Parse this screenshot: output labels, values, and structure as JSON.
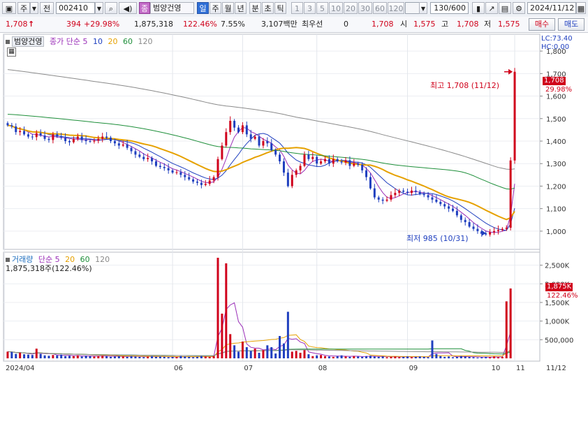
{
  "toolbar": {
    "mode_label": "주",
    "prev_label": "전",
    "code": "002410",
    "stock_badge": "종",
    "stock_name": "범양건영",
    "periods": [
      "일",
      "주",
      "월",
      "년",
      "분",
      "초",
      "틱"
    ],
    "active_period": "일",
    "intervals": [
      "1",
      "3",
      "5",
      "10",
      "20",
      "30",
      "60",
      "120"
    ],
    "count": "130/600",
    "date": "2024/11/12"
  },
  "quote": {
    "price": "1,708",
    "up_arrow": "↑",
    "change": "394",
    "change_pct": "+29.98%",
    "volume": "1,875,318",
    "volume_ratio": "122.46%",
    "turnover": "7.55%",
    "amount": "3,107백만",
    "pref_label": "최우선",
    "pref_value": "0",
    "best_ask": "1,708",
    "open_label": "시",
    "open": "1,575",
    "high_label": "고",
    "high": "1,708",
    "low_label": "저",
    "low": "1,575",
    "buy_label": "매수",
    "sell_label": "매도"
  },
  "price_panel": {
    "name_tag": "범양건영",
    "legend_prefix": "종가 단순",
    "ma": [
      {
        "period": "5",
        "color": "#9b2fb8"
      },
      {
        "period": "10",
        "color": "#1f3fbf"
      },
      {
        "period": "20",
        "color": "#e6a100"
      },
      {
        "period": "60",
        "color": "#1e8f3a"
      },
      {
        "period": "120",
        "color": "#8a8a8a"
      }
    ],
    "lc": "LC:73.40",
    "hc": "HC:0.00",
    "y_ticks": [
      "1,800",
      "1,700",
      "1,600",
      "1,500",
      "1,400",
      "1,300",
      "1,200",
      "1,100",
      "1,000"
    ],
    "current_price_tag": "1,708",
    "current_pct_tag": "29.98%",
    "high_annotation": "최고 1,708 (11/12)",
    "low_annotation": "최저 985 (10/31)"
  },
  "volume_panel": {
    "title": "거래량",
    "legend_prefix": "단순",
    "ma": [
      {
        "period": "5",
        "color": "#9b2fb8"
      },
      {
        "period": "20",
        "color": "#e6a100"
      },
      {
        "period": "60",
        "color": "#1e8f3a"
      },
      {
        "period": "120",
        "color": "#8a8a8a"
      }
    ],
    "readout": "1,875,318주(122.46%)",
    "y_ticks": [
      "2,500K",
      "2,000K",
      "1,500K",
      "1,000K",
      "500,000"
    ],
    "current_volume_tag": "1,875K",
    "current_volume_pct": "122.46%"
  },
  "x_axis": {
    "labels": [
      "2024/04",
      "06",
      "07",
      "08",
      "09",
      "10",
      "11"
    ],
    "end_label": "11/12"
  },
  "colors": {
    "up": "#d0021b",
    "down": "#1f3fbf"
  },
  "chart_data": {
    "type": "candlestick",
    "price_range": [
      950,
      1850
    ],
    "volume_range": [
      0,
      2700000
    ],
    "last_close": 1708,
    "high": {
      "value": 1708,
      "date": "11/12"
    },
    "low": {
      "value": 985,
      "date": "10/31"
    },
    "closes": [
      1470,
      1465,
      1440,
      1445,
      1430,
      1420,
      1418,
      1435,
      1425,
      1410,
      1405,
      1430,
      1420,
      1415,
      1400,
      1395,
      1410,
      1420,
      1405,
      1400,
      1398,
      1402,
      1410,
      1420,
      1415,
      1400,
      1390,
      1380,
      1385,
      1370,
      1355,
      1340,
      1330,
      1320,
      1325,
      1310,
      1290,
      1285,
      1280,
      1270,
      1260,
      1262,
      1250,
      1240,
      1230,
      1220,
      1215,
      1205,
      1210,
      1225,
      1240,
      1320,
      1380,
      1440,
      1490,
      1460,
      1440,
      1470,
      1430,
      1410,
      1420,
      1380,
      1400,
      1390,
      1360,
      1340,
      1310,
      1260,
      1200,
      1250,
      1270,
      1290,
      1340,
      1320,
      1330,
      1300,
      1310,
      1320,
      1300,
      1320,
      1310,
      1305,
      1315,
      1290,
      1300,
      1295,
      1270,
      1240,
      1190,
      1150,
      1140,
      1135,
      1140,
      1160,
      1170,
      1180,
      1175,
      1170,
      1180,
      1175,
      1165,
      1160,
      1150,
      1140,
      1130,
      1120,
      1110,
      1100,
      1090,
      1070,
      1050,
      1040,
      1020,
      1010,
      1000,
      990,
      985,
      995,
      1000,
      1005,
      1010,
      1015,
      1314,
      1708
    ],
    "volumes": [
      180000,
      170000,
      120000,
      150000,
      110000,
      100000,
      90000,
      260000,
      120000,
      80000,
      70000,
      90000,
      80000,
      100000,
      60000,
      70000,
      60000,
      80000,
      50000,
      70000,
      60000,
      50000,
      60000,
      70000,
      60000,
      40000,
      50000,
      60000,
      50000,
      40000,
      60000,
      50000,
      40000,
      30000,
      50000,
      60000,
      40000,
      50000,
      40000,
      30000,
      40000,
      30000,
      60000,
      50000,
      40000,
      30000,
      40000,
      60000,
      50000,
      40000,
      60000,
      2700000,
      1200000,
      2550000,
      650000,
      350000,
      180000,
      450000,
      300000,
      200000,
      260000,
      150000,
      220000,
      350000,
      300000,
      130000,
      600000,
      400000,
      1250000,
      180000,
      200000,
      150000,
      220000,
      110000,
      60000,
      80000,
      90000,
      60000,
      50000,
      40000,
      60000,
      80000,
      50000,
      40000,
      60000,
      50000,
      40000,
      60000,
      70000,
      50000,
      40000,
      50000,
      30000,
      40000,
      50000,
      30000,
      40000,
      50000,
      30000,
      40000,
      50000,
      40000,
      30000,
      480000,
      120000,
      60000,
      40000,
      50000,
      30000,
      40000,
      60000,
      50000,
      40000,
      30000,
      20000,
      30000,
      40000,
      30000,
      50000,
      30000,
      40000,
      1530000,
      1875318
    ]
  }
}
